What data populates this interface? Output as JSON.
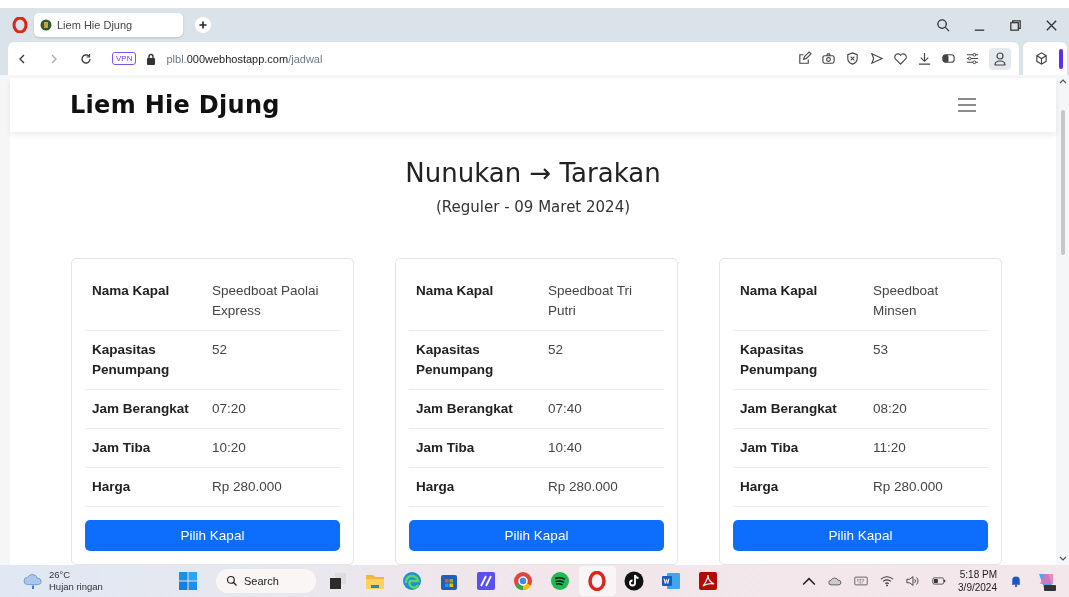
{
  "browser": {
    "tab": {
      "title": "Liem Hie Djung"
    },
    "address": {
      "vpn": "VPN",
      "subdomain": "plbl.",
      "domain": "000webhostapp.com",
      "path": "/jadwal"
    }
  },
  "navbar": {
    "brand": "Liem Hie Djung"
  },
  "route": {
    "title": "Nunukan → Tarakan",
    "subtitle": "(Reguler - 09 Maret 2024)"
  },
  "cards": [
    {
      "rows": [
        {
          "label": "Nama Kapal",
          "value": "Speedboat Paolai Express"
        },
        {
          "label": "Kapasitas Penumpang",
          "value": "52"
        },
        {
          "label": "Jam Berangkat",
          "value": "07:20"
        },
        {
          "label": "Jam Tiba",
          "value": "10:20"
        },
        {
          "label": "Harga",
          "value": "Rp 280.000"
        }
      ],
      "button": "Pilih Kapal"
    },
    {
      "rows": [
        {
          "label": "Nama Kapal",
          "value": "Speedboat Tri Putri"
        },
        {
          "label": "Kapasitas Penumpang",
          "value": "52"
        },
        {
          "label": "Jam Berangkat",
          "value": "07:40"
        },
        {
          "label": "Jam Tiba",
          "value": "10:40"
        },
        {
          "label": "Harga",
          "value": "Rp 280.000"
        }
      ],
      "button": "Pilih Kapal"
    },
    {
      "rows": [
        {
          "label": "Nama Kapal",
          "value": "Speedboat Minsen"
        },
        {
          "label": "Kapasitas Penumpang",
          "value": "53"
        },
        {
          "label": "Jam Berangkat",
          "value": "08:20"
        },
        {
          "label": "Jam Tiba",
          "value": "11:20"
        },
        {
          "label": "Harga",
          "value": "Rp 280.000"
        }
      ],
      "button": "Pilih Kapal"
    }
  ],
  "taskbar": {
    "weather": {
      "temperature": "26°C",
      "condition": "Hujan ringan"
    },
    "search": "Search",
    "apps": [
      {
        "kind": "taskview",
        "selected": false
      },
      {
        "kind": "files",
        "selected": false
      },
      {
        "kind": "edge",
        "selected": false
      },
      {
        "kind": "store",
        "selected": false
      },
      {
        "kind": "editor",
        "selected": false
      },
      {
        "kind": "chrome",
        "selected": false
      },
      {
        "kind": "spotify",
        "selected": false
      },
      {
        "kind": "opera",
        "selected": true
      },
      {
        "kind": "tiktok",
        "selected": false
      },
      {
        "kind": "word",
        "selected": false
      },
      {
        "kind": "pdf",
        "selected": false
      }
    ],
    "time": "5:18 PM",
    "date": "3/9/2024"
  }
}
